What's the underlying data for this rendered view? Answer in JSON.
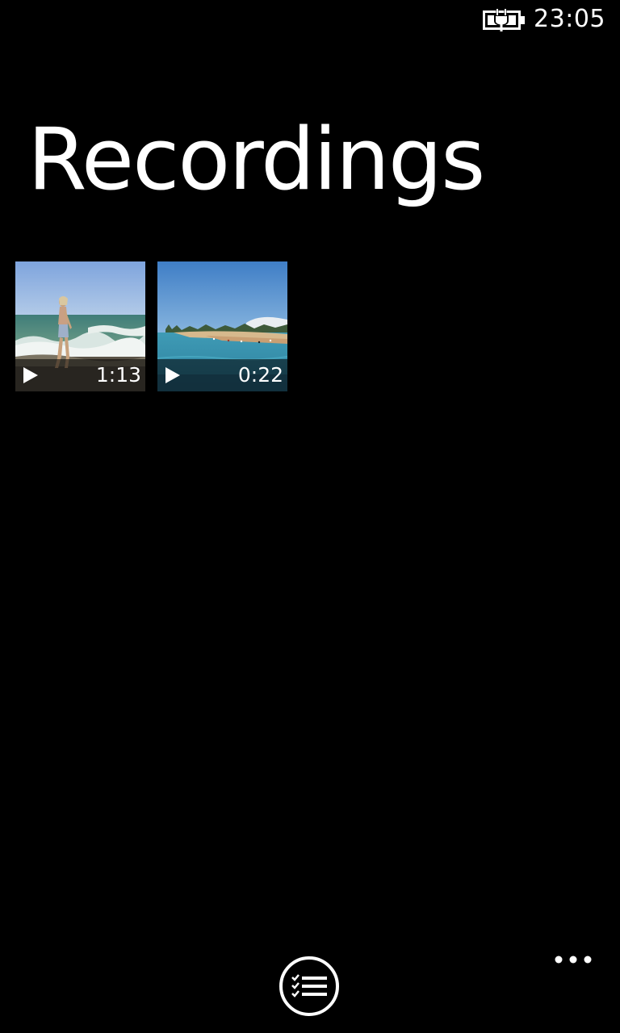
{
  "status_bar": {
    "battery_icon": "battery-charging-icon",
    "time": "23:05"
  },
  "page": {
    "title": "Recordings"
  },
  "recordings": [
    {
      "thumbnail": "beach-girl-waves",
      "duration": "1:13",
      "play_icon": "play-icon"
    },
    {
      "thumbnail": "beach-resort-shore",
      "duration": "0:22",
      "play_icon": "play-icon"
    }
  ],
  "app_bar": {
    "select_icon": "select-list-icon",
    "more_icon": "more-ellipsis-icon"
  },
  "colors": {
    "background": "#000000",
    "foreground": "#ffffff"
  }
}
